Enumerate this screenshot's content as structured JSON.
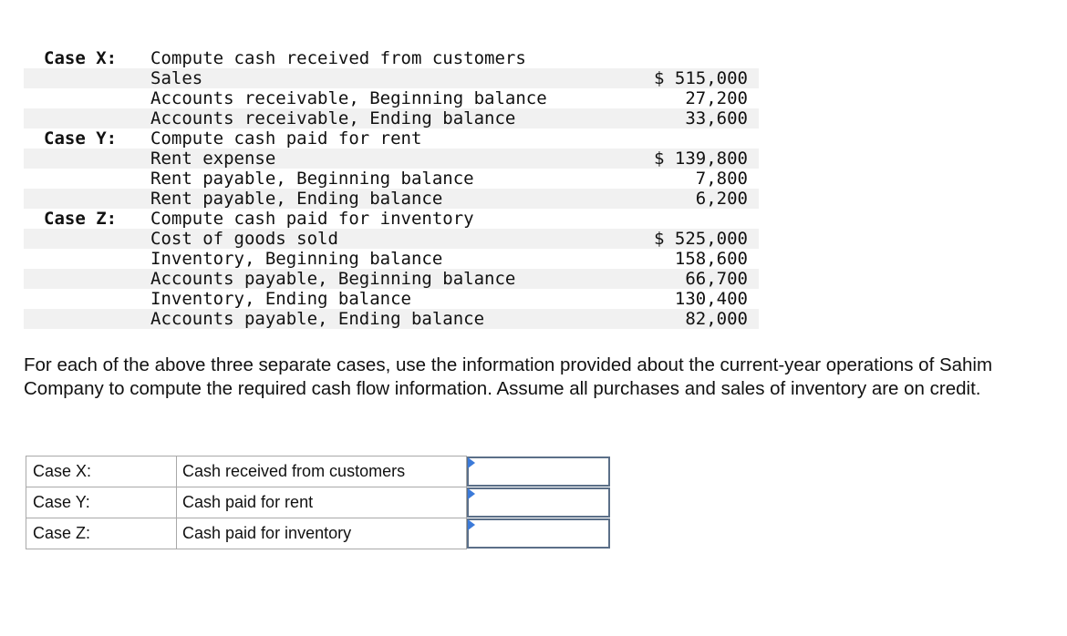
{
  "rows": [
    {
      "case": "Case X:",
      "desc": "Compute cash received from customers",
      "amount": "",
      "alt": false
    },
    {
      "case": "",
      "desc": "Sales",
      "amount": "$ 515,000",
      "alt": true
    },
    {
      "case": "",
      "desc": "Accounts receivable, Beginning balance",
      "amount": "27,200",
      "alt": false
    },
    {
      "case": "",
      "desc": "Accounts receivable, Ending balance",
      "amount": "33,600",
      "alt": true
    },
    {
      "case": "Case Y:",
      "desc": "Compute cash paid for rent",
      "amount": "",
      "alt": false
    },
    {
      "case": "",
      "desc": "Rent expense",
      "amount": "$ 139,800",
      "alt": true
    },
    {
      "case": "",
      "desc": "Rent payable, Beginning balance",
      "amount": "7,800",
      "alt": false
    },
    {
      "case": "",
      "desc": "Rent payable, Ending balance",
      "amount": "6,200",
      "alt": true
    },
    {
      "case": "Case Z:",
      "desc": "Compute cash paid for inventory",
      "amount": "",
      "alt": false
    },
    {
      "case": "",
      "desc": "Cost of goods sold",
      "amount": "$ 525,000",
      "alt": true
    },
    {
      "case": "",
      "desc": "Inventory, Beginning balance",
      "amount": "158,600",
      "alt": false
    },
    {
      "case": "",
      "desc": "Accounts payable, Beginning balance",
      "amount": "66,700",
      "alt": true
    },
    {
      "case": "",
      "desc": "Inventory, Ending balance",
      "amount": "130,400",
      "alt": false
    },
    {
      "case": "",
      "desc": "Accounts payable, Ending balance",
      "amount": "82,000",
      "alt": true
    }
  ],
  "instructions": "For each of the above three separate cases, use the information provided about the current-year operations of Sahim Company to compute the required cash flow information. Assume all purchases and sales of inventory are on credit.",
  "answer_rows": [
    {
      "case": "Case X:",
      "label": "Cash received from customers",
      "value": ""
    },
    {
      "case": "Case Y:",
      "label": "Cash paid for rent",
      "value": ""
    },
    {
      "case": "Case Z:",
      "label": "Cash paid for inventory",
      "value": ""
    }
  ],
  "colors": {
    "input_border": "#5b6f88",
    "marker": "#3b7ad9",
    "stripe": "#f1f1f1"
  }
}
